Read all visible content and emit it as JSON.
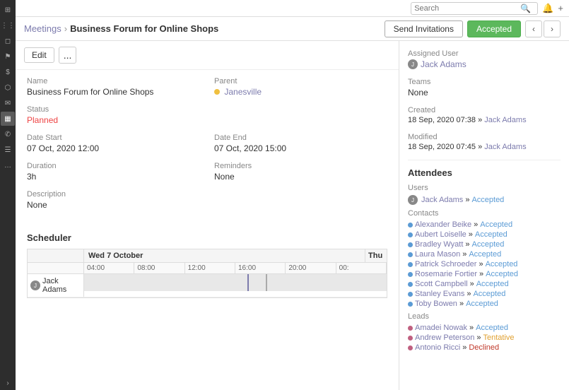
{
  "sidebar": {
    "icons": [
      {
        "name": "home-icon",
        "symbol": "⊞",
        "active": false
      },
      {
        "name": "apps-icon",
        "symbol": "⋮⋮",
        "active": false
      },
      {
        "name": "tag-icon",
        "symbol": "⬜",
        "active": false
      },
      {
        "name": "flag-icon",
        "symbol": "⚑",
        "active": false
      },
      {
        "name": "dollar-icon",
        "symbol": "$",
        "active": false
      },
      {
        "name": "briefcase-icon",
        "symbol": "⬜",
        "active": false
      },
      {
        "name": "envelope-icon",
        "symbol": "✉",
        "active": false
      },
      {
        "name": "calendar-icon",
        "symbol": "📅",
        "active": true
      },
      {
        "name": "phone-icon",
        "symbol": "✆",
        "active": false
      },
      {
        "name": "list-icon",
        "symbol": "☰",
        "active": false
      },
      {
        "name": "more-icon",
        "symbol": "…",
        "active": false
      }
    ],
    "expand_label": "›"
  },
  "topbar": {
    "search_placeholder": "Search"
  },
  "breadcrumb": {
    "parent_label": "Meetings",
    "separator": "›",
    "current_label": "Business Forum for Online Shops"
  },
  "actions": {
    "send_invitations_label": "Send Invitations",
    "status_label": "Accepted"
  },
  "toolbar": {
    "edit_label": "Edit",
    "dots_label": "..."
  },
  "form": {
    "name_label": "Name",
    "name_value": "Business Forum for Online Shops",
    "parent_label": "Parent",
    "parent_value": "Janesville",
    "status_label": "Status",
    "status_value": "Planned",
    "date_start_label": "Date Start",
    "date_start_value": "07 Oct, 2020 12:00",
    "date_end_label": "Date End",
    "date_end_value": "07 Oct, 2020 15:00",
    "duration_label": "Duration",
    "duration_value": "3h",
    "reminders_label": "Reminders",
    "reminders_value": "None",
    "description_label": "Description",
    "description_value": "None"
  },
  "scheduler": {
    "title": "Scheduler",
    "date_header": "Wed 7 October",
    "date_header2": "Thu",
    "times": [
      "04:00",
      "08:00",
      "12:00",
      "16:00",
      "20:00",
      "00:"
    ],
    "person": "Jack Adams",
    "marker1_pct": 54,
    "marker2_pct": 60
  },
  "right_panel": {
    "assigned_user_label": "Assigned User",
    "assigned_user_value": "Jack Adams",
    "teams_label": "Teams",
    "teams_value": "None",
    "created_label": "Created",
    "created_date": "18 Sep, 2020 07:38",
    "created_by": "Jack Adams",
    "modified_label": "Modified",
    "modified_date": "18 Sep, 2020 07:45",
    "modified_by": "Jack Adams",
    "attendees_title": "Attendees",
    "users_label": "Users",
    "users": [
      {
        "name": "Jack Adams",
        "status": "Accepted",
        "status_class": "status-accepted"
      }
    ],
    "contacts_label": "Contacts",
    "contacts": [
      {
        "name": "Alexander Beike",
        "status": "Accepted",
        "status_class": "status-accepted",
        "dot": "dot-blue"
      },
      {
        "name": "Aubert Loiselle",
        "status": "Accepted",
        "status_class": "status-accepted",
        "dot": "dot-blue"
      },
      {
        "name": "Bradley Wyatt",
        "status": "Accepted",
        "status_class": "status-accepted",
        "dot": "dot-blue"
      },
      {
        "name": "Laura Mason",
        "status": "Accepted",
        "status_class": "status-accepted",
        "dot": "dot-blue"
      },
      {
        "name": "Patrick Schroeder",
        "status": "Accepted",
        "status_class": "status-accepted",
        "dot": "dot-blue"
      },
      {
        "name": "Rosemarie Fortier",
        "status": "Accepted",
        "status_class": "status-accepted",
        "dot": "dot-blue"
      },
      {
        "name": "Scott Campbell",
        "status": "Accepted",
        "status_class": "status-accepted",
        "dot": "dot-blue"
      },
      {
        "name": "Stanley Evans",
        "status": "Accepted",
        "status_class": "status-accepted",
        "dot": "dot-blue"
      },
      {
        "name": "Toby Bowen",
        "status": "Accepted",
        "status_class": "status-accepted",
        "dot": "dot-blue"
      }
    ],
    "leads_label": "Leads",
    "leads": [
      {
        "name": "Amadei Nowak",
        "status": "Accepted",
        "status_class": "status-accepted",
        "dot": "dot-pink"
      },
      {
        "name": "Andrew Peterson",
        "status": "Tentative",
        "status_class": "status-tentative",
        "dot": "dot-pink"
      },
      {
        "name": "Antonio Ricci",
        "status": "Declined",
        "status_class": "status-declined",
        "dot": "dot-pink"
      }
    ]
  }
}
